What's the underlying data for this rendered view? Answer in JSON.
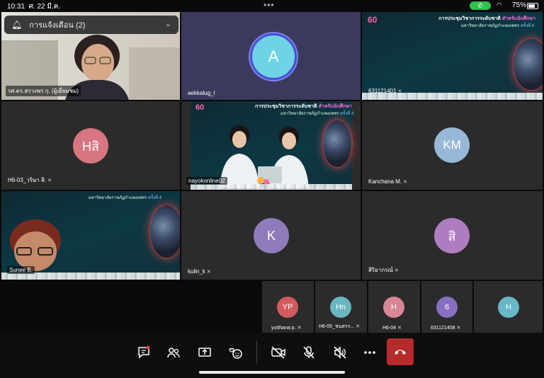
{
  "status_bar": {
    "time": "10:31",
    "date": "ศ. 22 มี.ค.",
    "battery": "75%",
    "call_indicator": "phone-icon"
  },
  "notification": {
    "text": "การแจ้งเตือน (2)",
    "icon": "bell-icon"
  },
  "slide": {
    "title_prefix": "การประชุมวิชาการระดับชาติ",
    "title_highlight": "สำหรับนักศึกษา",
    "subtitle": "มหาวิทยาลัยราชภัฏกำแพงเพชร",
    "subtitle_highlight": "ครั้งที่ 4"
  },
  "tiles": [
    {
      "label": "รศ.ดร.สรวงพร กุ. (ผู้เยี่ยมชม)"
    },
    {
      "label": "aekkalug_l",
      "initial": "A",
      "avatar_color": "#6fd3e6"
    },
    {
      "label": "631121401"
    },
    {
      "label": "H6-03_วริษา สิ.",
      "initial": "Hสิ",
      "avatar_color": "#d77580"
    },
    {
      "label": "nayokonline02"
    },
    {
      "label": "Kanchana M.",
      "initial": "KM",
      "avatar_color": "#98b8d8"
    },
    {
      "label": "Sunee B."
    },
    {
      "label": "kulin_k",
      "initial": "K",
      "avatar_color": "#8f7aba"
    },
    {
      "label": "สิริยากรณ์",
      "initial": "สิ",
      "avatar_color": "#b07cc0"
    }
  ],
  "small_tiles": [
    {
      "label": "yutthana p.",
      "initial": "YP",
      "avatar_color": "#d25a5f"
    },
    {
      "label": "H6-05_ชนสรร...",
      "initial": "Hn",
      "avatar_color": "#6ab6c0"
    },
    {
      "label": "H6-04",
      "initial": "H",
      "avatar_color": "#d88695"
    },
    {
      "label": "631121408",
      "initial": "6",
      "avatar_color": "#8a6fc0"
    },
    {
      "label": "",
      "initial": "H",
      "avatar_color": "#67b7c9"
    }
  ],
  "toolbar": [
    "chat-icon",
    "participants-icon",
    "share-screen-icon",
    "reactions-icon",
    "video-off-icon",
    "mic-off-icon",
    "speaker-off-icon",
    "more-icon",
    "end-call-icon"
  ],
  "colors": {
    "background": "#0a0a0a",
    "tile": "#2b2b2b",
    "active_tile": "#3b3a5c",
    "end_call": "#b52b2b"
  }
}
